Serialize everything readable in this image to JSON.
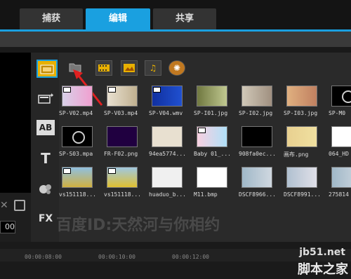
{
  "tabs": [
    {
      "label": "捕获",
      "active": false
    },
    {
      "label": "编辑",
      "active": true
    },
    {
      "label": "共享",
      "active": false
    }
  ],
  "accent_color": "#1aa0e0",
  "preview": {
    "timecode": "00"
  },
  "rail": [
    {
      "icon": "media-library-icon"
    },
    {
      "icon": "instant-project-icon"
    },
    {
      "label": "AB",
      "icon": "transition-icon"
    },
    {
      "label": "T",
      "icon": "title-icon"
    },
    {
      "icon": "graphic-icon"
    },
    {
      "label": "FX",
      "icon": "filter-icon"
    }
  ],
  "library_toolbar": [
    {
      "icon": "folder-icon"
    },
    {
      "icon": "video-filter-icon"
    },
    {
      "icon": "photo-filter-icon"
    },
    {
      "icon": "music-filter-icon"
    },
    {
      "icon": "global-icon"
    }
  ],
  "thumbnails": [
    {
      "name": "SP-V02.mp4",
      "type": "video"
    },
    {
      "name": "SP-V03.mp4",
      "type": "video"
    },
    {
      "name": "SP-V04.wmv",
      "type": "video"
    },
    {
      "name": "SP-I01.jpg",
      "type": "image"
    },
    {
      "name": "SP-I02.jpg",
      "type": "image"
    },
    {
      "name": "SP-I03.jpg",
      "type": "image"
    },
    {
      "name": "SP-M0",
      "type": "audio"
    },
    {
      "name": "SP-S03.mpa",
      "type": "audio"
    },
    {
      "name": "FR-F02.png",
      "type": "image"
    },
    {
      "name": "94ea5774...",
      "type": "image"
    },
    {
      "name": "Baby 01_...",
      "type": "video"
    },
    {
      "name": "908fa0ec...",
      "type": "image"
    },
    {
      "name": "画布.png",
      "type": "image"
    },
    {
      "name": "064_HD",
      "type": "image"
    },
    {
      "name": "vs151118...",
      "type": "video"
    },
    {
      "name": "vs151118...",
      "type": "video"
    },
    {
      "name": "huaduo_b...",
      "type": "image"
    },
    {
      "name": "M11.bmp",
      "type": "image"
    },
    {
      "name": "DSCF8966...",
      "type": "image"
    },
    {
      "name": "DSCF8991...",
      "type": "image"
    },
    {
      "name": "275814",
      "type": "image"
    }
  ],
  "watermark": "百度ID:天然河与你相约",
  "timeline_ticks": [
    "00:00:08:00",
    "00:00:10:00",
    "00:00:12:00"
  ],
  "site": {
    "domain": "jb51.net",
    "name": "脚本之家"
  }
}
